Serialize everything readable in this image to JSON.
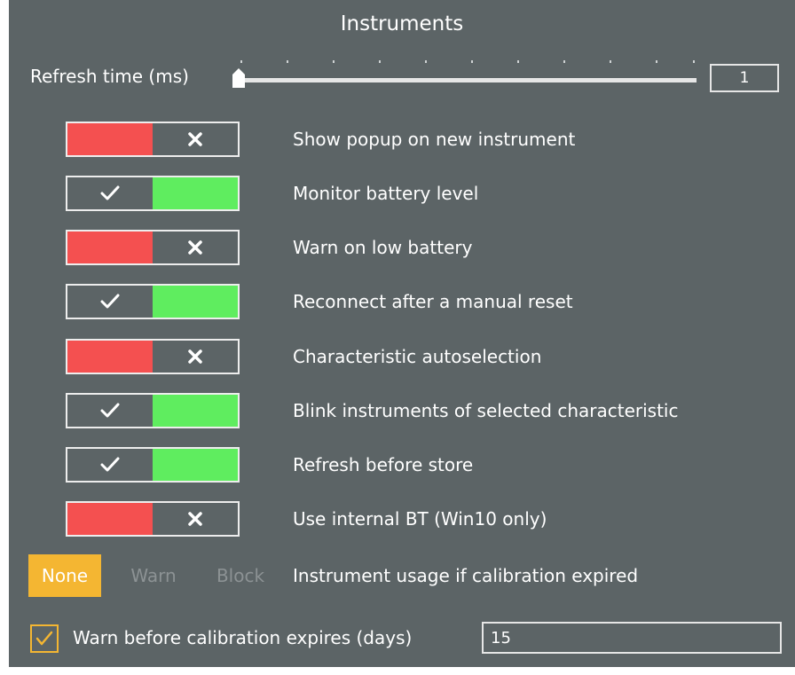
{
  "panel": {
    "title": "Instruments"
  },
  "refresh": {
    "label": "Refresh time (ms)",
    "value": "1",
    "slider_position": 0
  },
  "settings": [
    {
      "label": "Show popup on new instrument",
      "enabled": false
    },
    {
      "label": "Monitor battery level",
      "enabled": true
    },
    {
      "label": "Warn on low battery",
      "enabled": false
    },
    {
      "label": "Reconnect after a manual reset",
      "enabled": true
    },
    {
      "label": "Characteristic autoselection",
      "enabled": false
    },
    {
      "label": "Blink instruments of selected characteristic",
      "enabled": true
    },
    {
      "label": "Refresh before store",
      "enabled": true
    },
    {
      "label": "Use internal BT (Win10 only)",
      "enabled": false
    }
  ],
  "calibration_usage": {
    "options": [
      "None",
      "Warn",
      "Block"
    ],
    "selected": "None",
    "label": "Instrument usage if calibration expired"
  },
  "calibration_warning": {
    "checked": true,
    "label": "Warn before calibration expires (days)",
    "days": "15"
  },
  "colors": {
    "panel_bg": "#5c6466",
    "off_red": "#f45050",
    "on_green": "#5fed5f",
    "accent_amber": "#f4b632",
    "inactive_text": "#8c9294"
  },
  "icons": {
    "toggle_on": "check-icon",
    "toggle_off": "x-icon",
    "checkbox": "check-icon",
    "slider_thumb": "slider-thumb-icon"
  }
}
